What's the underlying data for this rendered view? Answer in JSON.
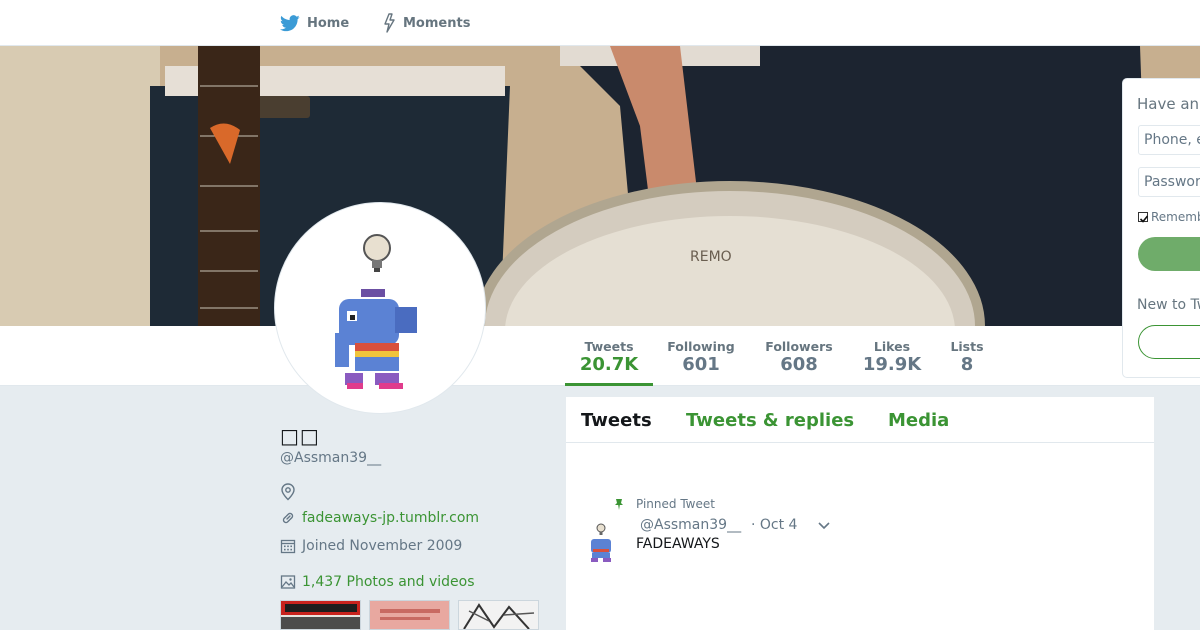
{
  "colors": {
    "accent": "#3b9434",
    "muted": "#657786",
    "background": "#e6ecf0"
  },
  "topnav": {
    "home_label": "Home",
    "home_icon": "twitter-bird-icon",
    "moments_label": "Moments",
    "moments_icon": "lightning-icon"
  },
  "stats": [
    {
      "label": "Tweets",
      "value": "20.7K"
    },
    {
      "label": "Following",
      "value": "601"
    },
    {
      "label": "Followers",
      "value": "608"
    },
    {
      "label": "Likes",
      "value": "19.9K"
    },
    {
      "label": "Lists",
      "value": "8"
    }
  ],
  "profile": {
    "name": "□□",
    "handle": "@Assman39__",
    "website": "fadeaways-jp.tumblr.com",
    "joined": "Joined November 2009",
    "photos": "1,437 Photos and videos"
  },
  "timeline": {
    "tabs": [
      "Tweets",
      "Tweets & replies",
      "Media"
    ],
    "tweet": {
      "pinned_label": "Pinned Tweet",
      "handle": "@Assman39__",
      "time": "· Oct 4",
      "text": "FADEAWAYS"
    }
  },
  "login": {
    "title": "Have an",
    "phone_placeholder": "Phone, e",
    "password_placeholder": "Passwor",
    "remember": "Rememb",
    "new_to": "New to Tw"
  }
}
